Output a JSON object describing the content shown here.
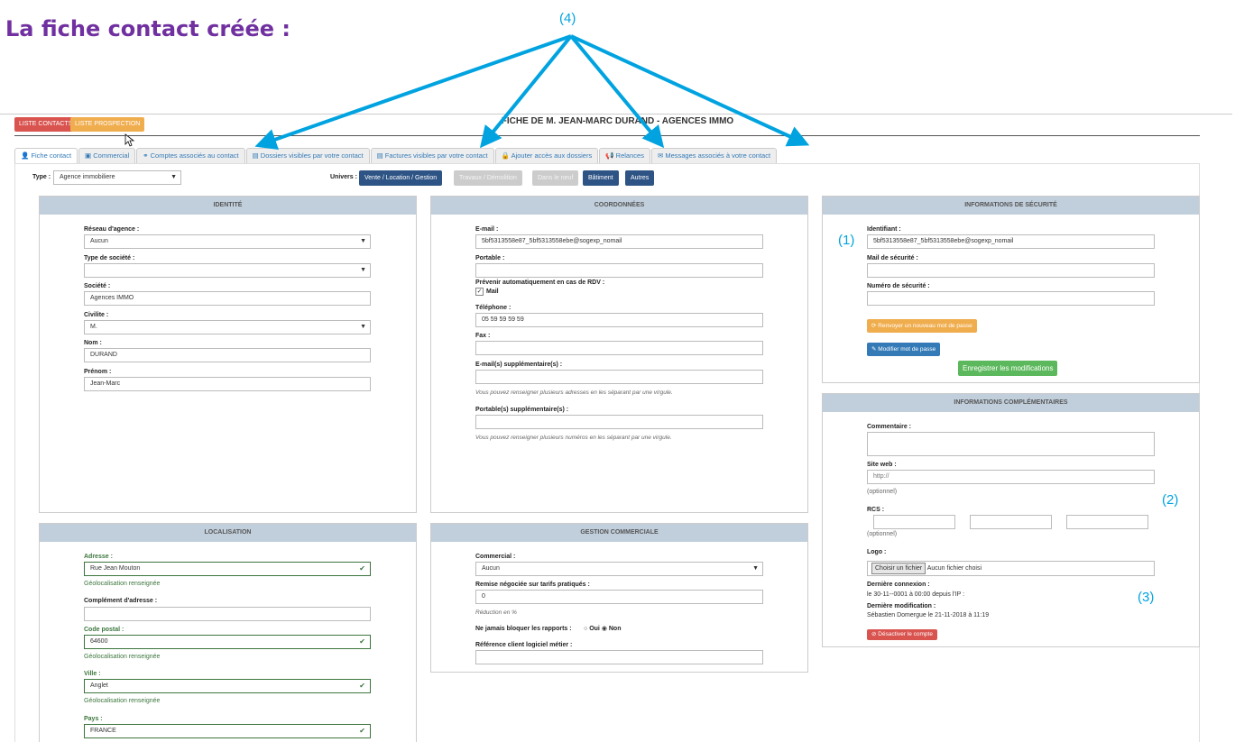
{
  "annotation": {
    "heading": "La fiche contact créée :",
    "label_4": "(4)",
    "label_1": "(1)",
    "label_2": "(2)",
    "label_3": "(3)",
    "arrow_color": "#00a3e0"
  },
  "top_buttons": {
    "contacts": "LISTE CONTACTS",
    "prospection": "LISTE PROSPECTION"
  },
  "page_title": "FICHE DE M. JEAN-MARC DURAND - AGENCES IMMO",
  "tabs": [
    {
      "icon": "user-icon",
      "label": "Fiche contact"
    },
    {
      "icon": "briefcase-icon",
      "label": "Commercial"
    },
    {
      "icon": "link-icon",
      "label": "Comptes associés au contact"
    },
    {
      "icon": "file-icon",
      "label": "Dossiers visibles par votre contact"
    },
    {
      "icon": "file-icon",
      "label": "Factures visibles par votre contact"
    },
    {
      "icon": "lock-icon",
      "label": "Ajouter accès aux dossiers"
    },
    {
      "icon": "bullhorn-icon",
      "label": "Relances"
    },
    {
      "icon": "envelope-icon",
      "label": "Messages associés à votre contact"
    }
  ],
  "type": {
    "label": "Type :",
    "value": "Agence immobiliere"
  },
  "univers": {
    "label": "Univers :",
    "options": [
      {
        "label": "Vente / Location / Gestion",
        "active": true
      },
      {
        "label": "Travaux / Démolition",
        "active": false
      },
      {
        "label": "Dans le neuf",
        "active": false
      },
      {
        "label": "Bâtiment",
        "active": true
      },
      {
        "label": "Autres",
        "active": true
      }
    ]
  },
  "identite": {
    "title": "IDENTITÉ",
    "reseau_label": "Réseau d'agence :",
    "reseau_value": "Aucun",
    "type_societe_label": "Type de société :",
    "type_societe_value": "",
    "societe_label": "Société :",
    "societe_value": "Agences IMMO",
    "civilite_label": "Civilite :",
    "civilite_value": "M.",
    "nom_label": "Nom :",
    "nom_value": "DURAND",
    "prenom_label": "Prénom :",
    "prenom_value": "Jean-Marc"
  },
  "coordonnees": {
    "title": "COORDONNÉES",
    "email_label": "E-mail :",
    "email_value": "5bf5313558e87_5bf5313558ebe@sogexp_nomail",
    "portable_label": "Portable :",
    "portable_value": "",
    "prevenir_label": "Prévenir automatiquement en cas de RDV :",
    "mail_label": "Mail",
    "telephone_label": "Téléphone :",
    "telephone_value": "05 59 59 59 59",
    "fax_label": "Fax :",
    "fax_value": "",
    "emails_sup_label": "E-mail(s) supplémentaire(s) :",
    "emails_sup_help": "Vous pouvez renseigner plusieurs adresses en les séparant par une virgule.",
    "portables_sup_label": "Portable(s) supplémentaire(s) :",
    "portables_sup_help": "Vous pouvez renseigner plusieurs numéros en les séparant par une virgule."
  },
  "securite": {
    "title": "INFORMATIONS DE SÉCURITÉ",
    "identifiant_label": "Identifiant :",
    "identifiant_value": "5bf5313558e87_5bf5313558ebe@sogexp_nomail",
    "mail_securite_label": "Mail de sécurité :",
    "numero_label": "Numéro de sécurité :",
    "renvoyer_btn": "Renvoyer un nouveau mot de passe",
    "modifier_btn": "Modifier mot de passe",
    "enregistrer_btn": "Enregistrer les modifications"
  },
  "complementaires": {
    "title": "INFORMATIONS COMPLÉMENTAIRES",
    "commentaire_label": "Commentaire :",
    "site_label": "Site web :",
    "site_placeholder": "http://",
    "optional": "(optionnel)",
    "rcs_label": "RCS :",
    "logo_label": "Logo :",
    "file_btn": "Choisir un fichier",
    "file_status": "Aucun fichier choisi",
    "derniere_connexion_label": "Dernière connexion :",
    "derniere_connexion_value": "le 30-11--0001 à 00:00 depuis l'IP :",
    "derniere_modif_label": "Dernière modification :",
    "derniere_modif_value": "Sébastien Domergue le 21-11-2018 à 11:19",
    "desactiver_btn": "Désactiver le compte"
  },
  "localisation": {
    "title": "LOCALISATION",
    "adresse_label": "Adresse :",
    "adresse_value": "Rue Jean Mouton",
    "geo": "Géolocalisation renseignée",
    "complement_label": "Complément d'adresse :",
    "cp_label": "Code postal :",
    "cp_value": "64600",
    "ville_label": "Ville :",
    "ville_value": "Anglet",
    "pays_label": "Pays :",
    "pays_value": "FRANCE"
  },
  "gestion": {
    "title": "GESTION COMMERCIALE",
    "commercial_label": "Commercial :",
    "commercial_value": "Aucun",
    "remise_label": "Remise négociée sur tarifs pratiqués :",
    "remise_value": "0",
    "remise_help": "Réduction en %",
    "bloquer_label": "Ne jamais bloquer les rapports :",
    "oui": "Oui",
    "non": "Non",
    "reference_label": "Référence client logiciel métier :"
  }
}
